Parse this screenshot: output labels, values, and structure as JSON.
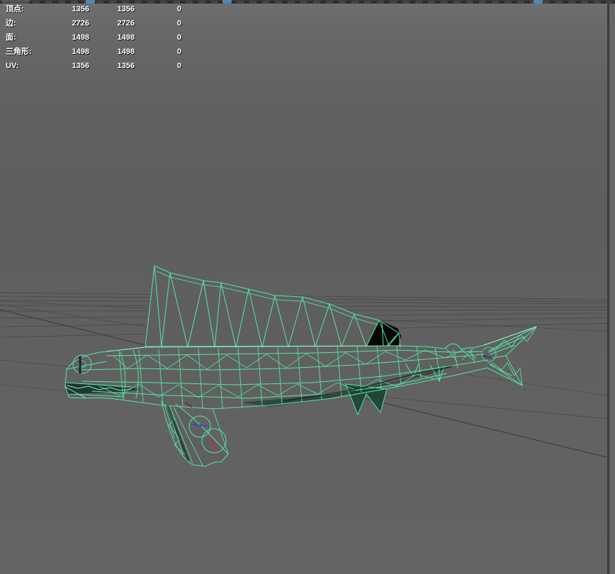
{
  "window": {
    "title": "3D viewport (perspective view)"
  },
  "toolbar": {
    "description": "cropped viewport toolbar, only bottom edge of icon row visible",
    "highlighted_icons": [
      "wireframe-mode-icon",
      "shading-mode-icon",
      "grid-toggle-icon"
    ],
    "highlight_color": "#4f87b5"
  },
  "hud": {
    "description": "poly count heads-up display",
    "rows": [
      {
        "label": "顶点:",
        "col1": "1356",
        "col2": "1356",
        "col3": "0"
      },
      {
        "label": "边:",
        "col1": "2726",
        "col2": "2726",
        "col3": "0"
      },
      {
        "label": "面:",
        "col1": "1498",
        "col2": "1498",
        "col3": "0"
      },
      {
        "label": "三角形:",
        "col1": "1498",
        "col2": "1498",
        "col3": "0"
      },
      {
        "label": "UV:",
        "col1": "1356",
        "col2": "1356",
        "col3": "0"
      }
    ]
  },
  "scene": {
    "model": "low-poly sailfish / fish wireframe, selected",
    "wireframe_color": "#55e6a4",
    "wireframe_highlight": "#a5f4d0",
    "background_gray": "#616161",
    "grid_line_color": "#4b4b4b",
    "shaded_black_face": "#060606",
    "manipulator_colors": {
      "blue": "#2b4fd0",
      "red": "#b03a3a",
      "navy": "#16203f"
    }
  }
}
